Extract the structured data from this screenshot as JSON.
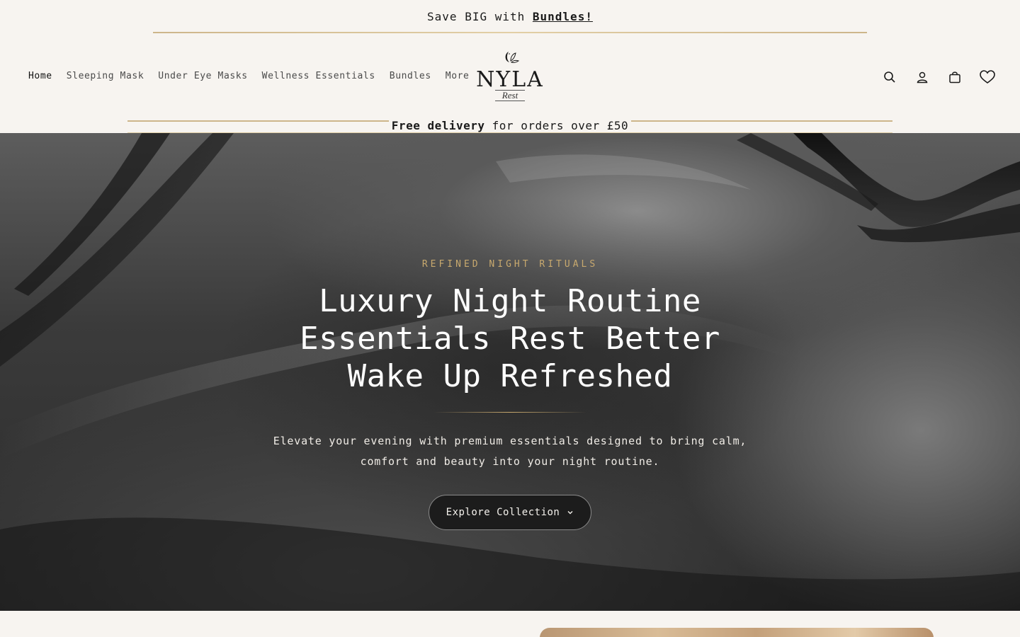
{
  "announcement": {
    "prefix": "Save BIG with ",
    "link": "Bundles!"
  },
  "nav": {
    "items": [
      {
        "label": "Home",
        "active": true
      },
      {
        "label": "Sleeping Mask",
        "active": false
      },
      {
        "label": "Under Eye Masks",
        "active": false
      },
      {
        "label": "Wellness Essentials",
        "active": false
      },
      {
        "label": "Bundles",
        "active": false
      },
      {
        "label": "More",
        "active": false
      }
    ]
  },
  "logo": {
    "word": "NYLA",
    "sub": "Rest"
  },
  "header_icons": [
    "search-icon",
    "account-icon",
    "cart-icon",
    "wishlist-heart-icon"
  ],
  "delivery": {
    "strong": "Free delivery",
    "rest": " for orders over £50"
  },
  "hero": {
    "eyebrow": "REFINED NIGHT RITUALS",
    "title": "Luxury Night Routine Essentials Rest Better Wake Up Refreshed",
    "subtitle": "Elevate your evening with premium essentials designed to bring calm, comfort and beauty into your night routine.",
    "cta_label": "Explore Collection"
  },
  "colors": {
    "background": "#f7f4f0",
    "gold_accent": "#c8a96e",
    "hero_text": "#ffffff",
    "cta_background": "#1c1c1c"
  }
}
